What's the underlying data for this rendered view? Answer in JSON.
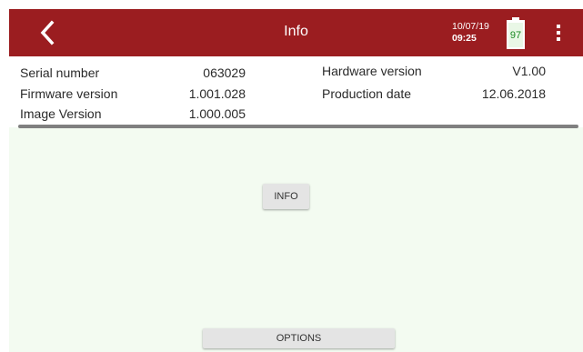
{
  "header": {
    "title": "Info",
    "date": "10/07/19",
    "time": "09:25",
    "battery_level": "97",
    "battery_fraction": 0.97,
    "back_icon": "chevron-left-icon",
    "menu_icon": "more-vertical-icon",
    "bar_color": "#9b1d20"
  },
  "device_info": {
    "serial_number_label": "Serial number",
    "serial_number_value": "063029",
    "firmware_version_label": "Firmware version",
    "firmware_version_value": "1.001.028",
    "image_version_label": "Image Version",
    "image_version_value": "1.000.005",
    "hardware_version_label": "Hardware version",
    "hardware_version_value": "V1.00",
    "production_date_label": "Production date",
    "production_date_value": "12.06.2018"
  },
  "buttons": {
    "info_label": "INFO",
    "options_label": "OPTIONS"
  }
}
